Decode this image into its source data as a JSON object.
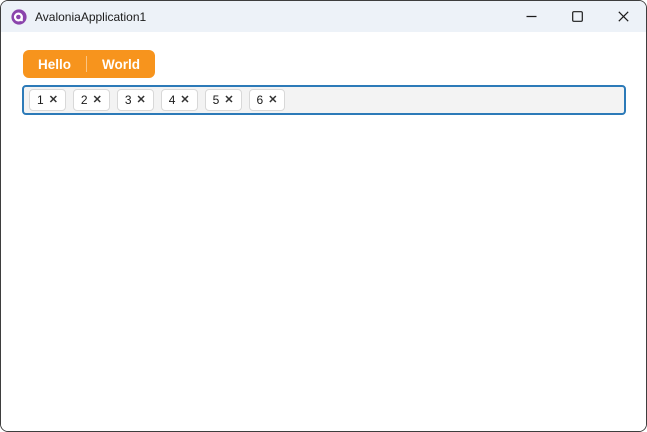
{
  "window": {
    "title": "AvaloniaApplication1"
  },
  "tabs": [
    {
      "label": "Hello"
    },
    {
      "label": "World"
    }
  ],
  "chip_input": {
    "chips": [
      {
        "value": "1"
      },
      {
        "value": "2"
      },
      {
        "value": "3"
      },
      {
        "value": "4"
      },
      {
        "value": "5"
      },
      {
        "value": "6"
      }
    ],
    "remove_glyph": "✕"
  },
  "colors": {
    "accent_orange": "#F7941D",
    "focus_border_blue": "#2C7AB8",
    "logo_purple": "#8B44AC",
    "titlebar_bg": "#EDF2F8",
    "window_border": "#3E3E3E"
  }
}
